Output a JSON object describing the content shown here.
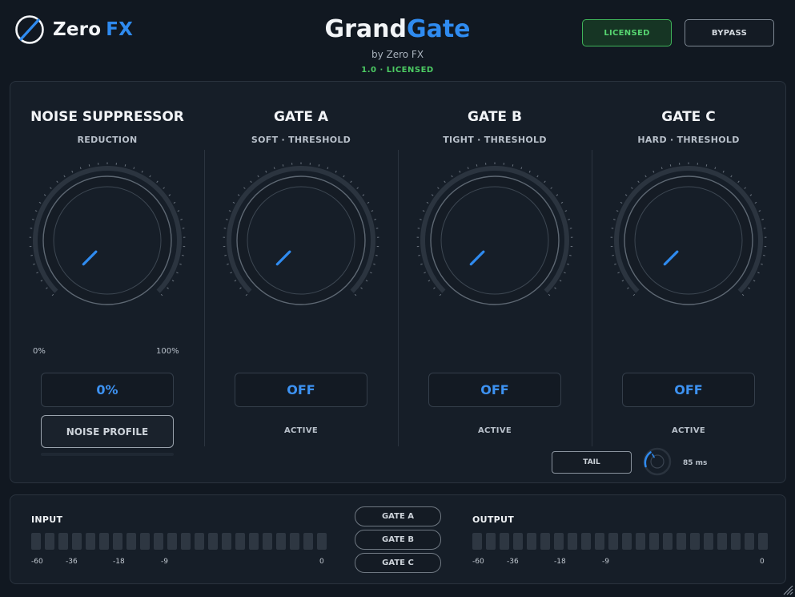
{
  "brand": {
    "word1": "Zero",
    "word2": "FX"
  },
  "title": {
    "part1": "Grand",
    "part2": "Gate",
    "byline": "by Zero FX",
    "version": "1.0 · LICENSED"
  },
  "header_buttons": {
    "licensed": "LICENSED",
    "bypass": "BYPASS"
  },
  "modules": [
    {
      "title": "NOISE SUPPRESSOR",
      "subtitle": "REDUCTION",
      "value": "0%",
      "min_label": "0%",
      "max_label": "100%",
      "button": "NOISE PROFILE"
    },
    {
      "title": "GATE A",
      "subtitle": "SOFT · THRESHOLD",
      "value": "OFF",
      "status": "ACTIVE"
    },
    {
      "title": "GATE B",
      "subtitle": "TIGHT · THRESHOLD",
      "value": "OFF",
      "status": "ACTIVE"
    },
    {
      "title": "GATE C",
      "subtitle": "HARD · THRESHOLD",
      "value": "OFF",
      "status": "ACTIVE"
    }
  ],
  "tail": {
    "label": "TAIL",
    "value": "85 ms"
  },
  "meters": {
    "input": {
      "label": "INPUT",
      "level": 0
    },
    "output": {
      "label": "OUTPUT",
      "level": 0
    },
    "scale": [
      "-60",
      "-36",
      "-18",
      "-9",
      "0"
    ]
  },
  "gate_selector": [
    "GATE A",
    "GATE B",
    "GATE C"
  ],
  "colors": {
    "accent": "#2f8bf0",
    "licensed": "#4ccb63",
    "background": "#111821"
  },
  "knob_levels": [
    0,
    0,
    0,
    0
  ]
}
